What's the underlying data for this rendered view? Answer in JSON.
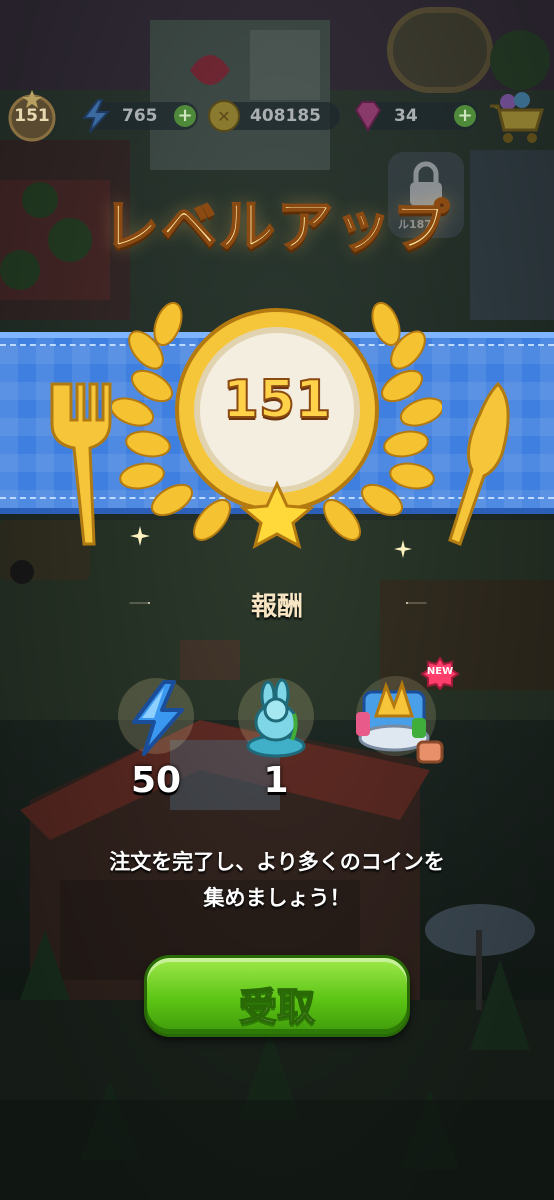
{
  "hud": {
    "player_level": "151",
    "energy": "765",
    "coins": "408185",
    "gems": "34",
    "locked_label": "ル187"
  },
  "popup": {
    "title": "レベルアップ",
    "new_level": "151",
    "rewards_title": "報酬",
    "rewards": [
      {
        "icon": "energy-bolt-icon",
        "amount": "50"
      },
      {
        "icon": "rabbit-statue-icon",
        "amount": "1"
      },
      {
        "icon": "decoration-item-icon",
        "amount": ""
      }
    ],
    "new_badge": "NEW",
    "message_line1": "注文を完了し、より多くのコインを",
    "message_line2": "集めましょう！",
    "claim_label": "受取"
  },
  "colors": {
    "title": "#ffe39a",
    "ribbon": "#3f7fe0",
    "button": "#5cc414",
    "gold": "#ffd24a"
  }
}
